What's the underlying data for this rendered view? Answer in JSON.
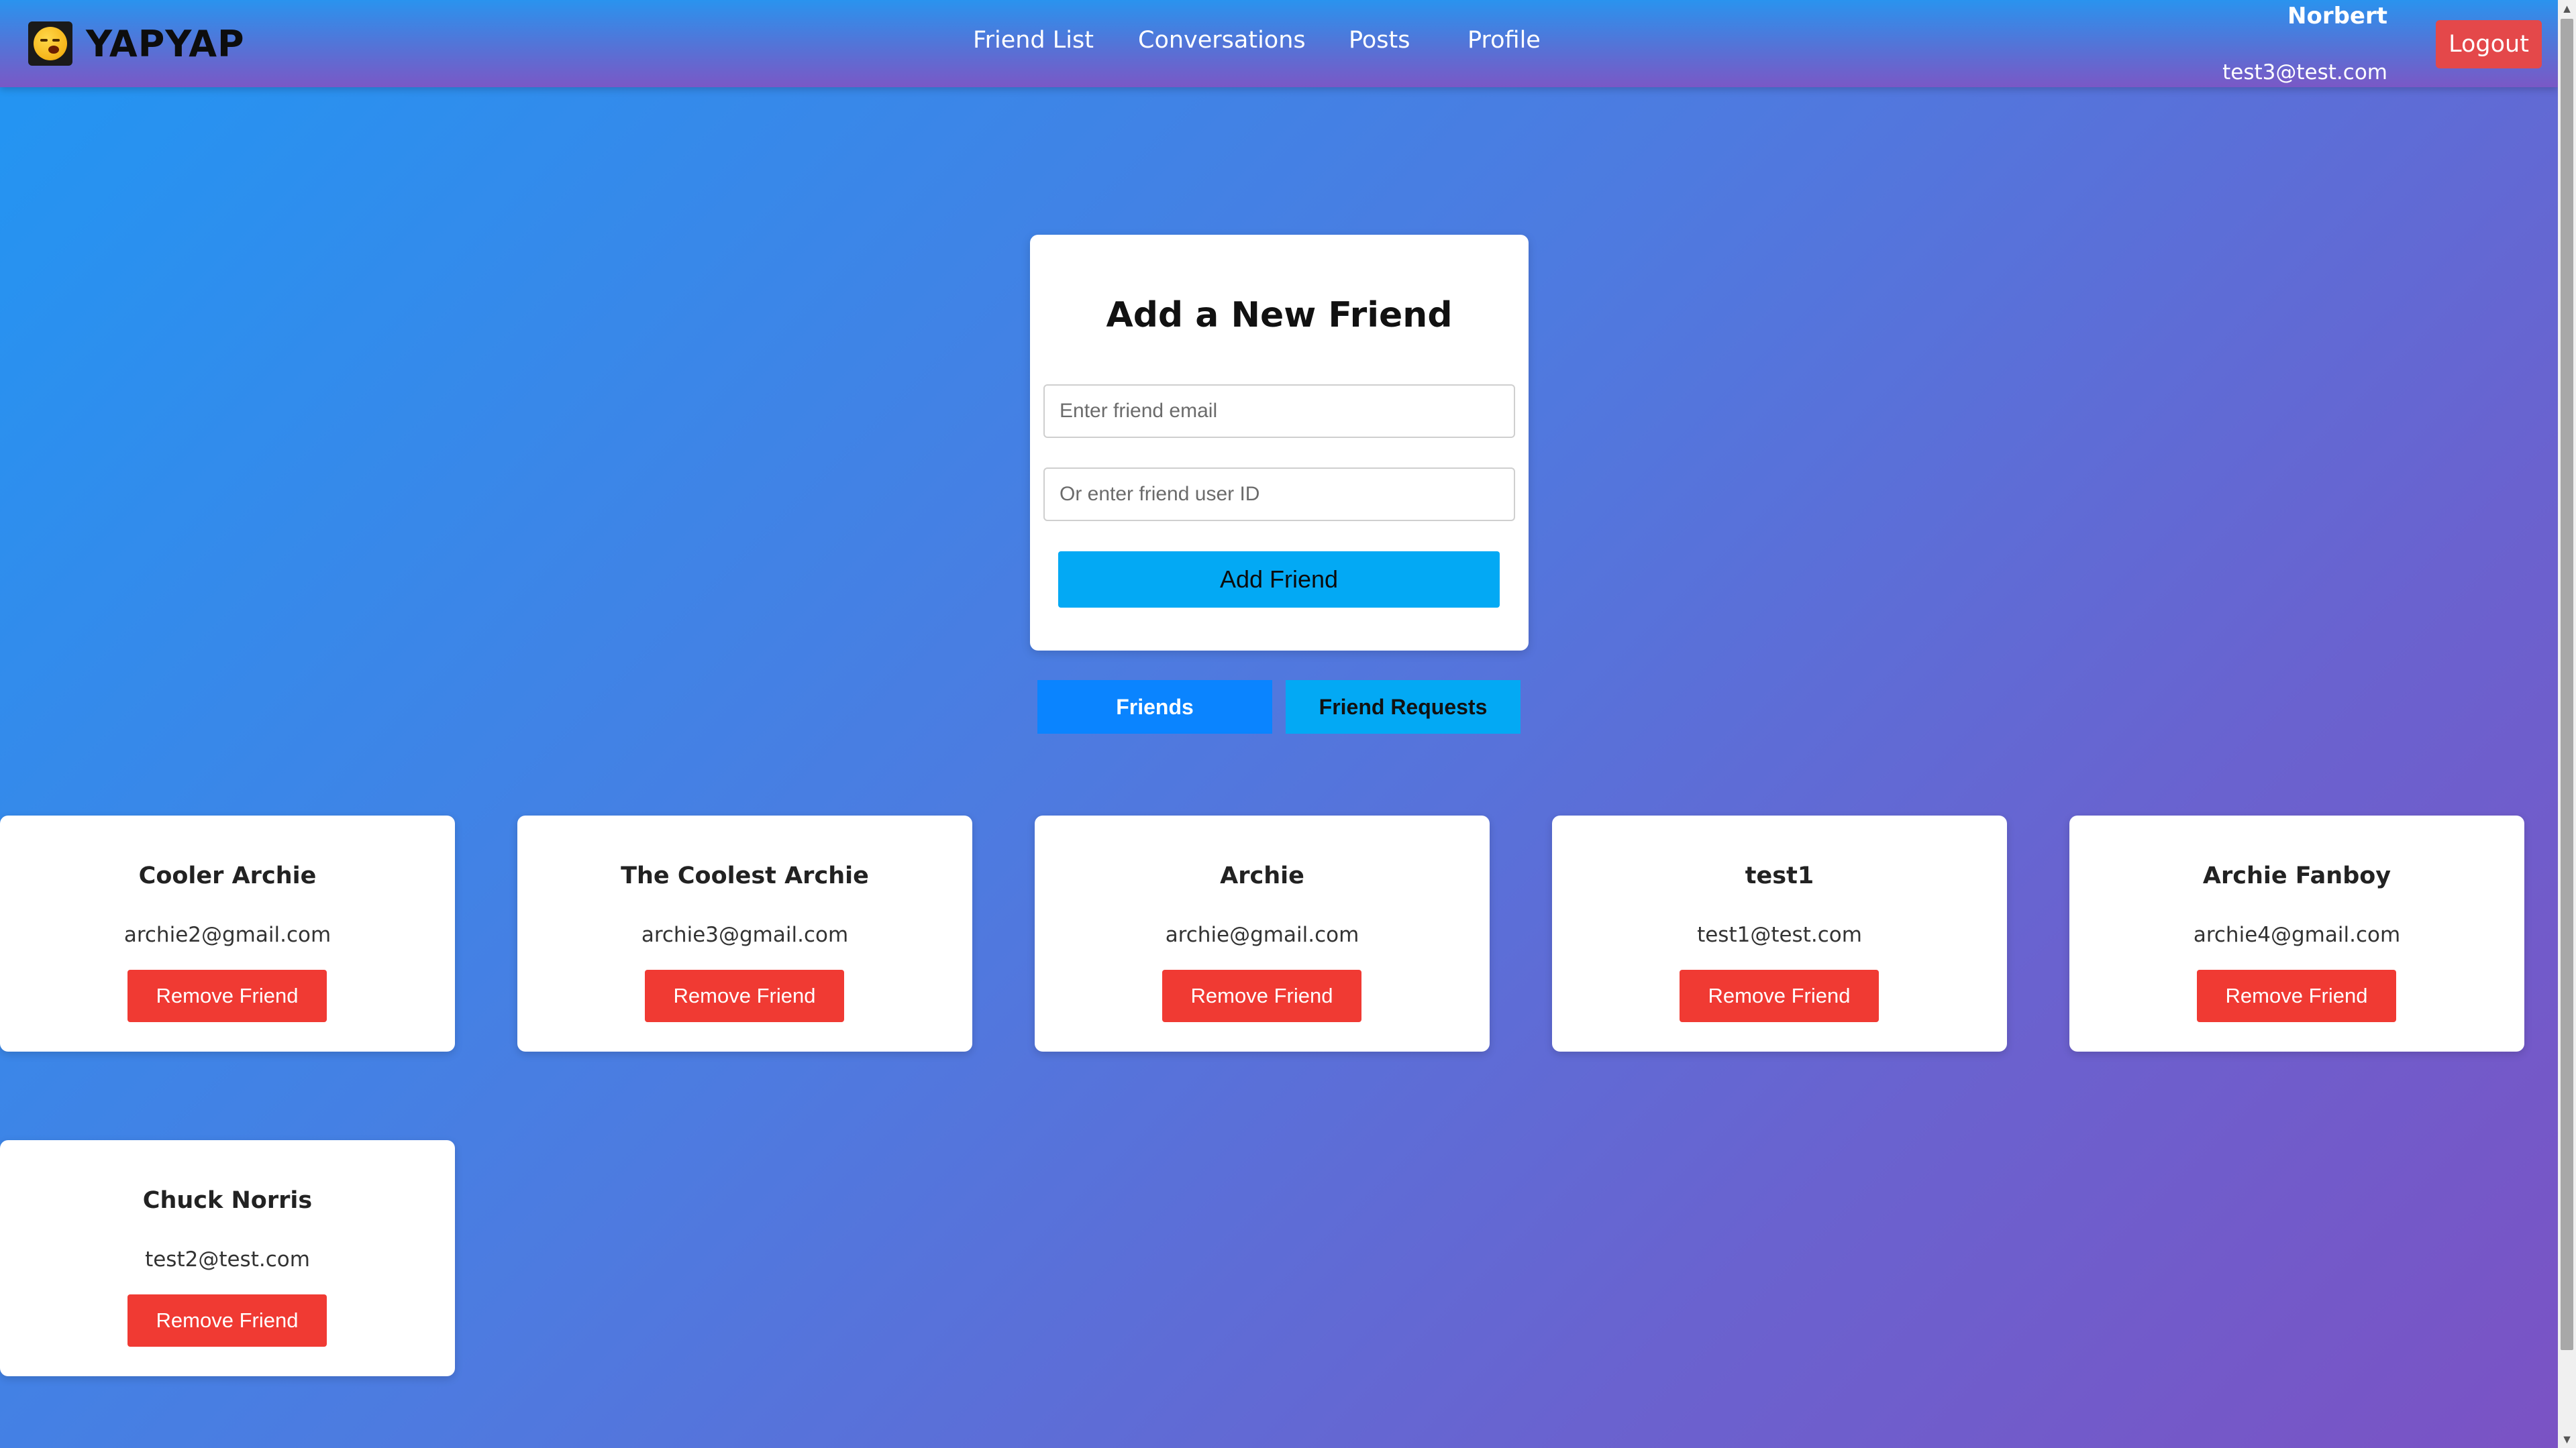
{
  "header": {
    "brand": "YAPYAP",
    "logo_icon": "yawning-face-icon",
    "nav": [
      {
        "label": "Friend List"
      },
      {
        "label": "Conversations"
      },
      {
        "label": "Posts"
      },
      {
        "label": "Profile"
      }
    ],
    "user": {
      "name": "Norbert",
      "email": "test3@test.com"
    },
    "logout_label": "Logout"
  },
  "add_friend": {
    "title": "Add a New Friend",
    "email_placeholder": "Enter friend email",
    "email_value": "",
    "userid_placeholder": "Or enter friend user ID",
    "userid_value": "",
    "button_label": "Add Friend"
  },
  "tabs": {
    "friends": "Friends",
    "requests": "Friend Requests",
    "active": "friends"
  },
  "friends": [
    {
      "name": "Cooler Archie",
      "email": "archie2@gmail.com",
      "action": "Remove Friend"
    },
    {
      "name": "The Coolest Archie",
      "email": "archie3@gmail.com",
      "action": "Remove Friend"
    },
    {
      "name": "Archie",
      "email": "archie@gmail.com",
      "action": "Remove Friend"
    },
    {
      "name": "test1",
      "email": "test1@test.com",
      "action": "Remove Friend"
    },
    {
      "name": "Archie Fanboy",
      "email": "archie4@gmail.com",
      "action": "Remove Friend"
    },
    {
      "name": "Chuck Norris",
      "email": "test2@test.com",
      "action": "Remove Friend"
    }
  ],
  "colors": {
    "logout": "#e4484a",
    "add_button": "#03a9f4",
    "tab_active": "#0a84ff",
    "tab_inactive": "#03a9f4",
    "remove_button": "#f03a33"
  }
}
